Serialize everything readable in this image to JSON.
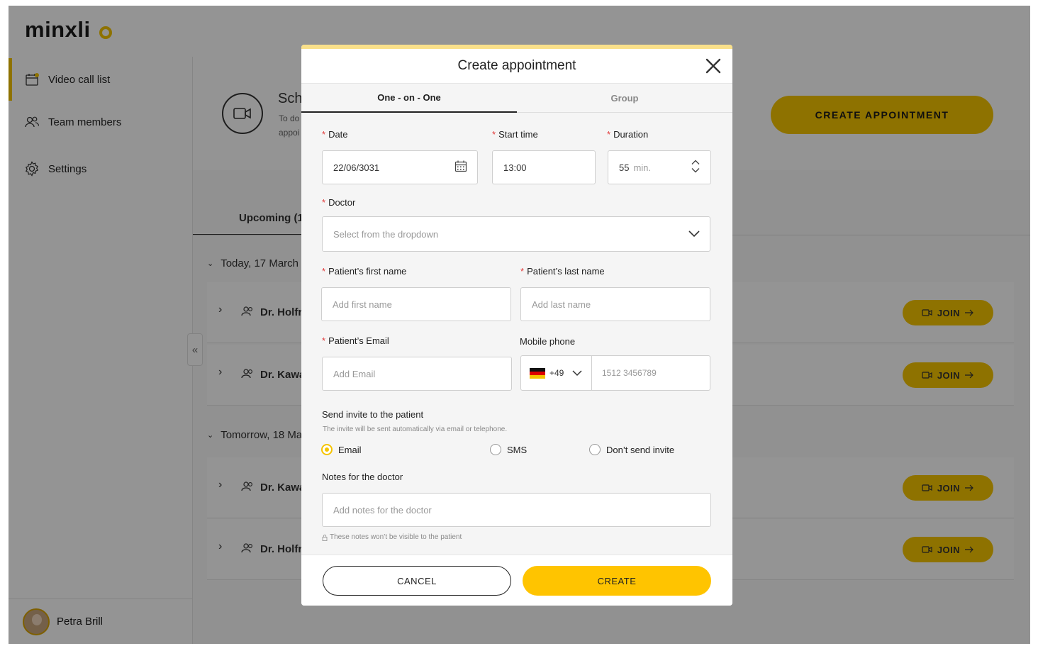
{
  "app": {
    "logo": "minxli",
    "colors": {
      "accent": "#f5c400",
      "required": "#e23b3b"
    }
  },
  "sidebar": {
    "items": [
      {
        "label": "Video call list",
        "icon": "calendar-icon"
      },
      {
        "label": "Team members",
        "icon": "users-icon"
      },
      {
        "label": "Settings",
        "icon": "gear-icon"
      }
    ],
    "user": {
      "name": "Petra Brill"
    }
  },
  "main": {
    "schedule_title": "Sch",
    "schedule_sub_1": "To do",
    "schedule_sub_2": "appoi",
    "create_button": "CREATE APPOINTMENT",
    "tab_upcoming": "Upcoming (1",
    "groups": [
      {
        "label": "Today, 17 March",
        "rows": [
          {
            "doctor": "Dr. Holfr"
          },
          {
            "doctor": "Dr. Kawa"
          }
        ]
      },
      {
        "label": "Tomorrow, 18 Ma",
        "rows": [
          {
            "doctor": "Dr. Kawa"
          },
          {
            "doctor": "Dr. Holfr"
          }
        ]
      }
    ],
    "join_label": "JOIN"
  },
  "modal": {
    "title": "Create appointment",
    "tabs": [
      "One - on - One",
      "Group"
    ],
    "date": {
      "label": "Date",
      "value": "22/06/3031"
    },
    "start_time": {
      "label": "Start time",
      "value": "13:00"
    },
    "duration": {
      "label": "Duration",
      "value": "55",
      "unit": "min."
    },
    "doctor": {
      "label": "Doctor",
      "placeholder": "Select from the dropdown"
    },
    "first_name": {
      "label": "Patient’s first name",
      "placeholder": "Add first name"
    },
    "last_name": {
      "label": "Patient’s last name",
      "placeholder": "Add last name"
    },
    "email": {
      "label": "Patient’s Email",
      "placeholder": "Add Email"
    },
    "mobile": {
      "label": "Mobile phone",
      "code": "+49",
      "placeholder": "1512 3456789"
    },
    "invite": {
      "label": "Send invite to the patient",
      "hint": "The invite will be sent automatically via email or telephone.",
      "options": [
        "Email",
        "SMS",
        "Don’t send invite"
      ],
      "selected": "Email"
    },
    "notes": {
      "label": "Notes for the doctor",
      "placeholder": "Add notes for the doctor",
      "hint": "These notes won’t be visible to the patient"
    },
    "cancel": "CANCEL",
    "create": "CREATE"
  }
}
